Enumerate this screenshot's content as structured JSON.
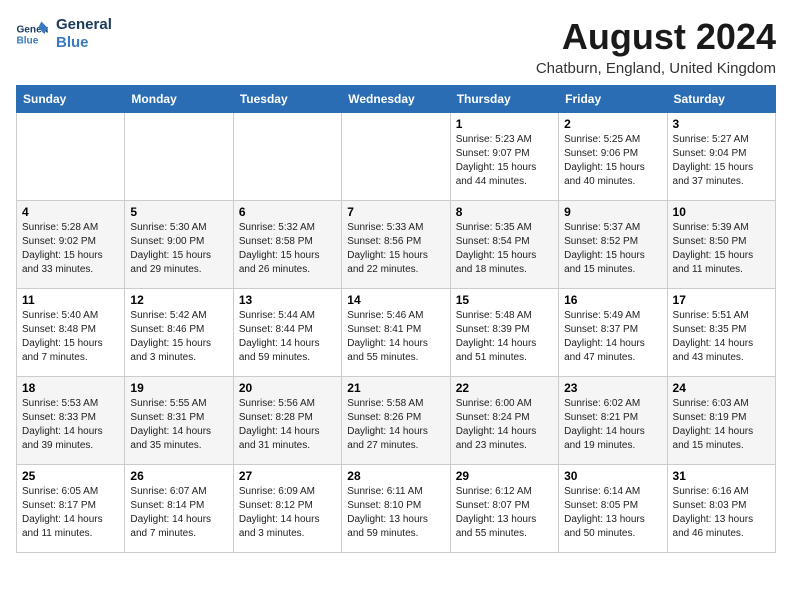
{
  "logo": {
    "line1": "General",
    "line2": "Blue"
  },
  "title": "August 2024",
  "location": "Chatburn, England, United Kingdom",
  "weekdays": [
    "Sunday",
    "Monday",
    "Tuesday",
    "Wednesday",
    "Thursday",
    "Friday",
    "Saturday"
  ],
  "weeks": [
    [
      {
        "date": "",
        "info": ""
      },
      {
        "date": "",
        "info": ""
      },
      {
        "date": "",
        "info": ""
      },
      {
        "date": "",
        "info": ""
      },
      {
        "date": "1",
        "info": "Sunrise: 5:23 AM\nSunset: 9:07 PM\nDaylight: 15 hours\nand 44 minutes."
      },
      {
        "date": "2",
        "info": "Sunrise: 5:25 AM\nSunset: 9:06 PM\nDaylight: 15 hours\nand 40 minutes."
      },
      {
        "date": "3",
        "info": "Sunrise: 5:27 AM\nSunset: 9:04 PM\nDaylight: 15 hours\nand 37 minutes."
      }
    ],
    [
      {
        "date": "4",
        "info": "Sunrise: 5:28 AM\nSunset: 9:02 PM\nDaylight: 15 hours\nand 33 minutes."
      },
      {
        "date": "5",
        "info": "Sunrise: 5:30 AM\nSunset: 9:00 PM\nDaylight: 15 hours\nand 29 minutes."
      },
      {
        "date": "6",
        "info": "Sunrise: 5:32 AM\nSunset: 8:58 PM\nDaylight: 15 hours\nand 26 minutes."
      },
      {
        "date": "7",
        "info": "Sunrise: 5:33 AM\nSunset: 8:56 PM\nDaylight: 15 hours\nand 22 minutes."
      },
      {
        "date": "8",
        "info": "Sunrise: 5:35 AM\nSunset: 8:54 PM\nDaylight: 15 hours\nand 18 minutes."
      },
      {
        "date": "9",
        "info": "Sunrise: 5:37 AM\nSunset: 8:52 PM\nDaylight: 15 hours\nand 15 minutes."
      },
      {
        "date": "10",
        "info": "Sunrise: 5:39 AM\nSunset: 8:50 PM\nDaylight: 15 hours\nand 11 minutes."
      }
    ],
    [
      {
        "date": "11",
        "info": "Sunrise: 5:40 AM\nSunset: 8:48 PM\nDaylight: 15 hours\nand 7 minutes."
      },
      {
        "date": "12",
        "info": "Sunrise: 5:42 AM\nSunset: 8:46 PM\nDaylight: 15 hours\nand 3 minutes."
      },
      {
        "date": "13",
        "info": "Sunrise: 5:44 AM\nSunset: 8:44 PM\nDaylight: 14 hours\nand 59 minutes."
      },
      {
        "date": "14",
        "info": "Sunrise: 5:46 AM\nSunset: 8:41 PM\nDaylight: 14 hours\nand 55 minutes."
      },
      {
        "date": "15",
        "info": "Sunrise: 5:48 AM\nSunset: 8:39 PM\nDaylight: 14 hours\nand 51 minutes."
      },
      {
        "date": "16",
        "info": "Sunrise: 5:49 AM\nSunset: 8:37 PM\nDaylight: 14 hours\nand 47 minutes."
      },
      {
        "date": "17",
        "info": "Sunrise: 5:51 AM\nSunset: 8:35 PM\nDaylight: 14 hours\nand 43 minutes."
      }
    ],
    [
      {
        "date": "18",
        "info": "Sunrise: 5:53 AM\nSunset: 8:33 PM\nDaylight: 14 hours\nand 39 minutes."
      },
      {
        "date": "19",
        "info": "Sunrise: 5:55 AM\nSunset: 8:31 PM\nDaylight: 14 hours\nand 35 minutes."
      },
      {
        "date": "20",
        "info": "Sunrise: 5:56 AM\nSunset: 8:28 PM\nDaylight: 14 hours\nand 31 minutes."
      },
      {
        "date": "21",
        "info": "Sunrise: 5:58 AM\nSunset: 8:26 PM\nDaylight: 14 hours\nand 27 minutes."
      },
      {
        "date": "22",
        "info": "Sunrise: 6:00 AM\nSunset: 8:24 PM\nDaylight: 14 hours\nand 23 minutes."
      },
      {
        "date": "23",
        "info": "Sunrise: 6:02 AM\nSunset: 8:21 PM\nDaylight: 14 hours\nand 19 minutes."
      },
      {
        "date": "24",
        "info": "Sunrise: 6:03 AM\nSunset: 8:19 PM\nDaylight: 14 hours\nand 15 minutes."
      }
    ],
    [
      {
        "date": "25",
        "info": "Sunrise: 6:05 AM\nSunset: 8:17 PM\nDaylight: 14 hours\nand 11 minutes."
      },
      {
        "date": "26",
        "info": "Sunrise: 6:07 AM\nSunset: 8:14 PM\nDaylight: 14 hours\nand 7 minutes."
      },
      {
        "date": "27",
        "info": "Sunrise: 6:09 AM\nSunset: 8:12 PM\nDaylight: 14 hours\nand 3 minutes."
      },
      {
        "date": "28",
        "info": "Sunrise: 6:11 AM\nSunset: 8:10 PM\nDaylight: 13 hours\nand 59 minutes."
      },
      {
        "date": "29",
        "info": "Sunrise: 6:12 AM\nSunset: 8:07 PM\nDaylight: 13 hours\nand 55 minutes."
      },
      {
        "date": "30",
        "info": "Sunrise: 6:14 AM\nSunset: 8:05 PM\nDaylight: 13 hours\nand 50 minutes."
      },
      {
        "date": "31",
        "info": "Sunrise: 6:16 AM\nSunset: 8:03 PM\nDaylight: 13 hours\nand 46 minutes."
      }
    ]
  ]
}
